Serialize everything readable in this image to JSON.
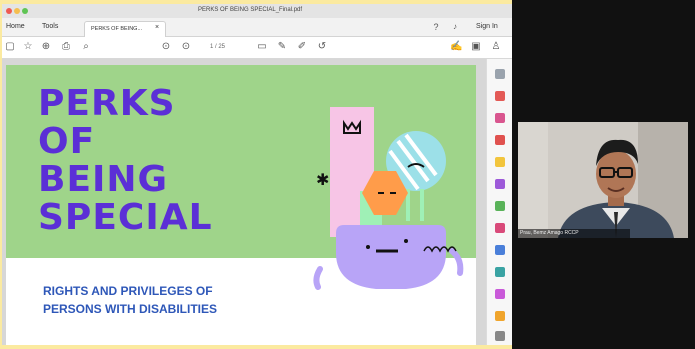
{
  "window": {
    "title": "PERKS OF BEING SPECIAL_Final.pdf"
  },
  "menubar": {
    "home": "Home",
    "tools": "Tools",
    "tab_label": "PERKS OF BEING...",
    "tab_close": "×",
    "sign_in": "Sign In"
  },
  "toolbar": {
    "page_indicator": "1 / 25"
  },
  "slide": {
    "title_lines": [
      "PERKS",
      "OF",
      "BEING",
      "SPECIAL"
    ],
    "subtitle_lines": [
      "RIGHTS AND PRIVILEGES OF",
      "PERSONS WITH DISABILITIES"
    ],
    "colors": {
      "green_bg": "#9fd48a",
      "title_purple": "#5b2fd6",
      "subtitle_blue": "#2e57b8"
    }
  },
  "video": {
    "name_tag": "Prau, Bemz Amago RCCP"
  },
  "icons": {
    "toolbar": [
      "save-icon",
      "star-icon",
      "upload-icon",
      "print-icon",
      "zoom-icon",
      "page-up-icon",
      "page-down-icon",
      "comment-icon",
      "pen-icon",
      "highlight-icon",
      "undo-icon",
      "sign-icon",
      "share-icon",
      "account-icon"
    ],
    "sidebar": [
      "search-icon",
      "export-pdf-icon",
      "edit-pdf-icon",
      "create-pdf-icon",
      "comment-icon",
      "combine-icon",
      "organize-icon",
      "redact-icon",
      "protect-icon",
      "optimize-icon",
      "fill-sign-icon",
      "more-tools-icon"
    ]
  }
}
